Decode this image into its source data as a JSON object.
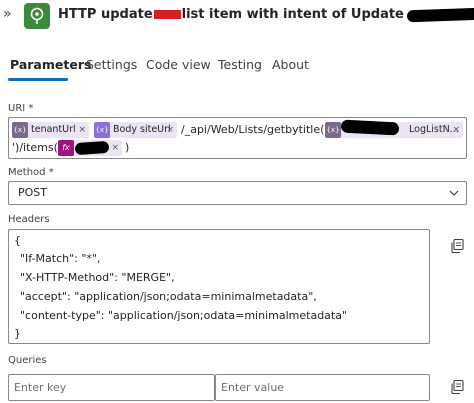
{
  "header": {
    "title_part1": "HTTP update",
    "title_part2": "list item with intent of Update"
  },
  "tabs": [
    {
      "label": "Parameters",
      "active": true
    },
    {
      "label": "Settings",
      "active": false
    },
    {
      "label": "Code view",
      "active": false
    },
    {
      "label": "Testing",
      "active": false
    },
    {
      "label": "About",
      "active": false
    }
  ],
  "uri": {
    "label": "URI *",
    "token_tenant": "tenantUrl",
    "token_site": "Body siteUrl",
    "text_path": "/_api/Web/Lists/getbytitle('",
    "token_list_suffix": "LogListN...",
    "text_items": "')/items(",
    "text_close": ")",
    "token_close_glyph": "×"
  },
  "method": {
    "label": "Method *",
    "value": "POST"
  },
  "headers": {
    "label": "Headers",
    "lines": [
      "{",
      "\"If-Match\": \"*\",",
      "\"X-HTTP-Method\": \"MERGE\",",
      "\"accept\": \"application/json;odata=minimalmetadata\",",
      "\"content-type\": \"application/json;odata=minimalmetadata\"",
      "}"
    ]
  },
  "queries": {
    "label": "Queries",
    "key_placeholder": "Enter key",
    "value_placeholder": "Enter value"
  },
  "colors": {
    "accent": "#0f6cbd",
    "flow_icon": "#3e8a3c",
    "variable_token": "#7c6a8e",
    "expression_token": "#a4127d",
    "parameter_token": "#8b6fe0",
    "redaction_red": "#d81f26"
  }
}
